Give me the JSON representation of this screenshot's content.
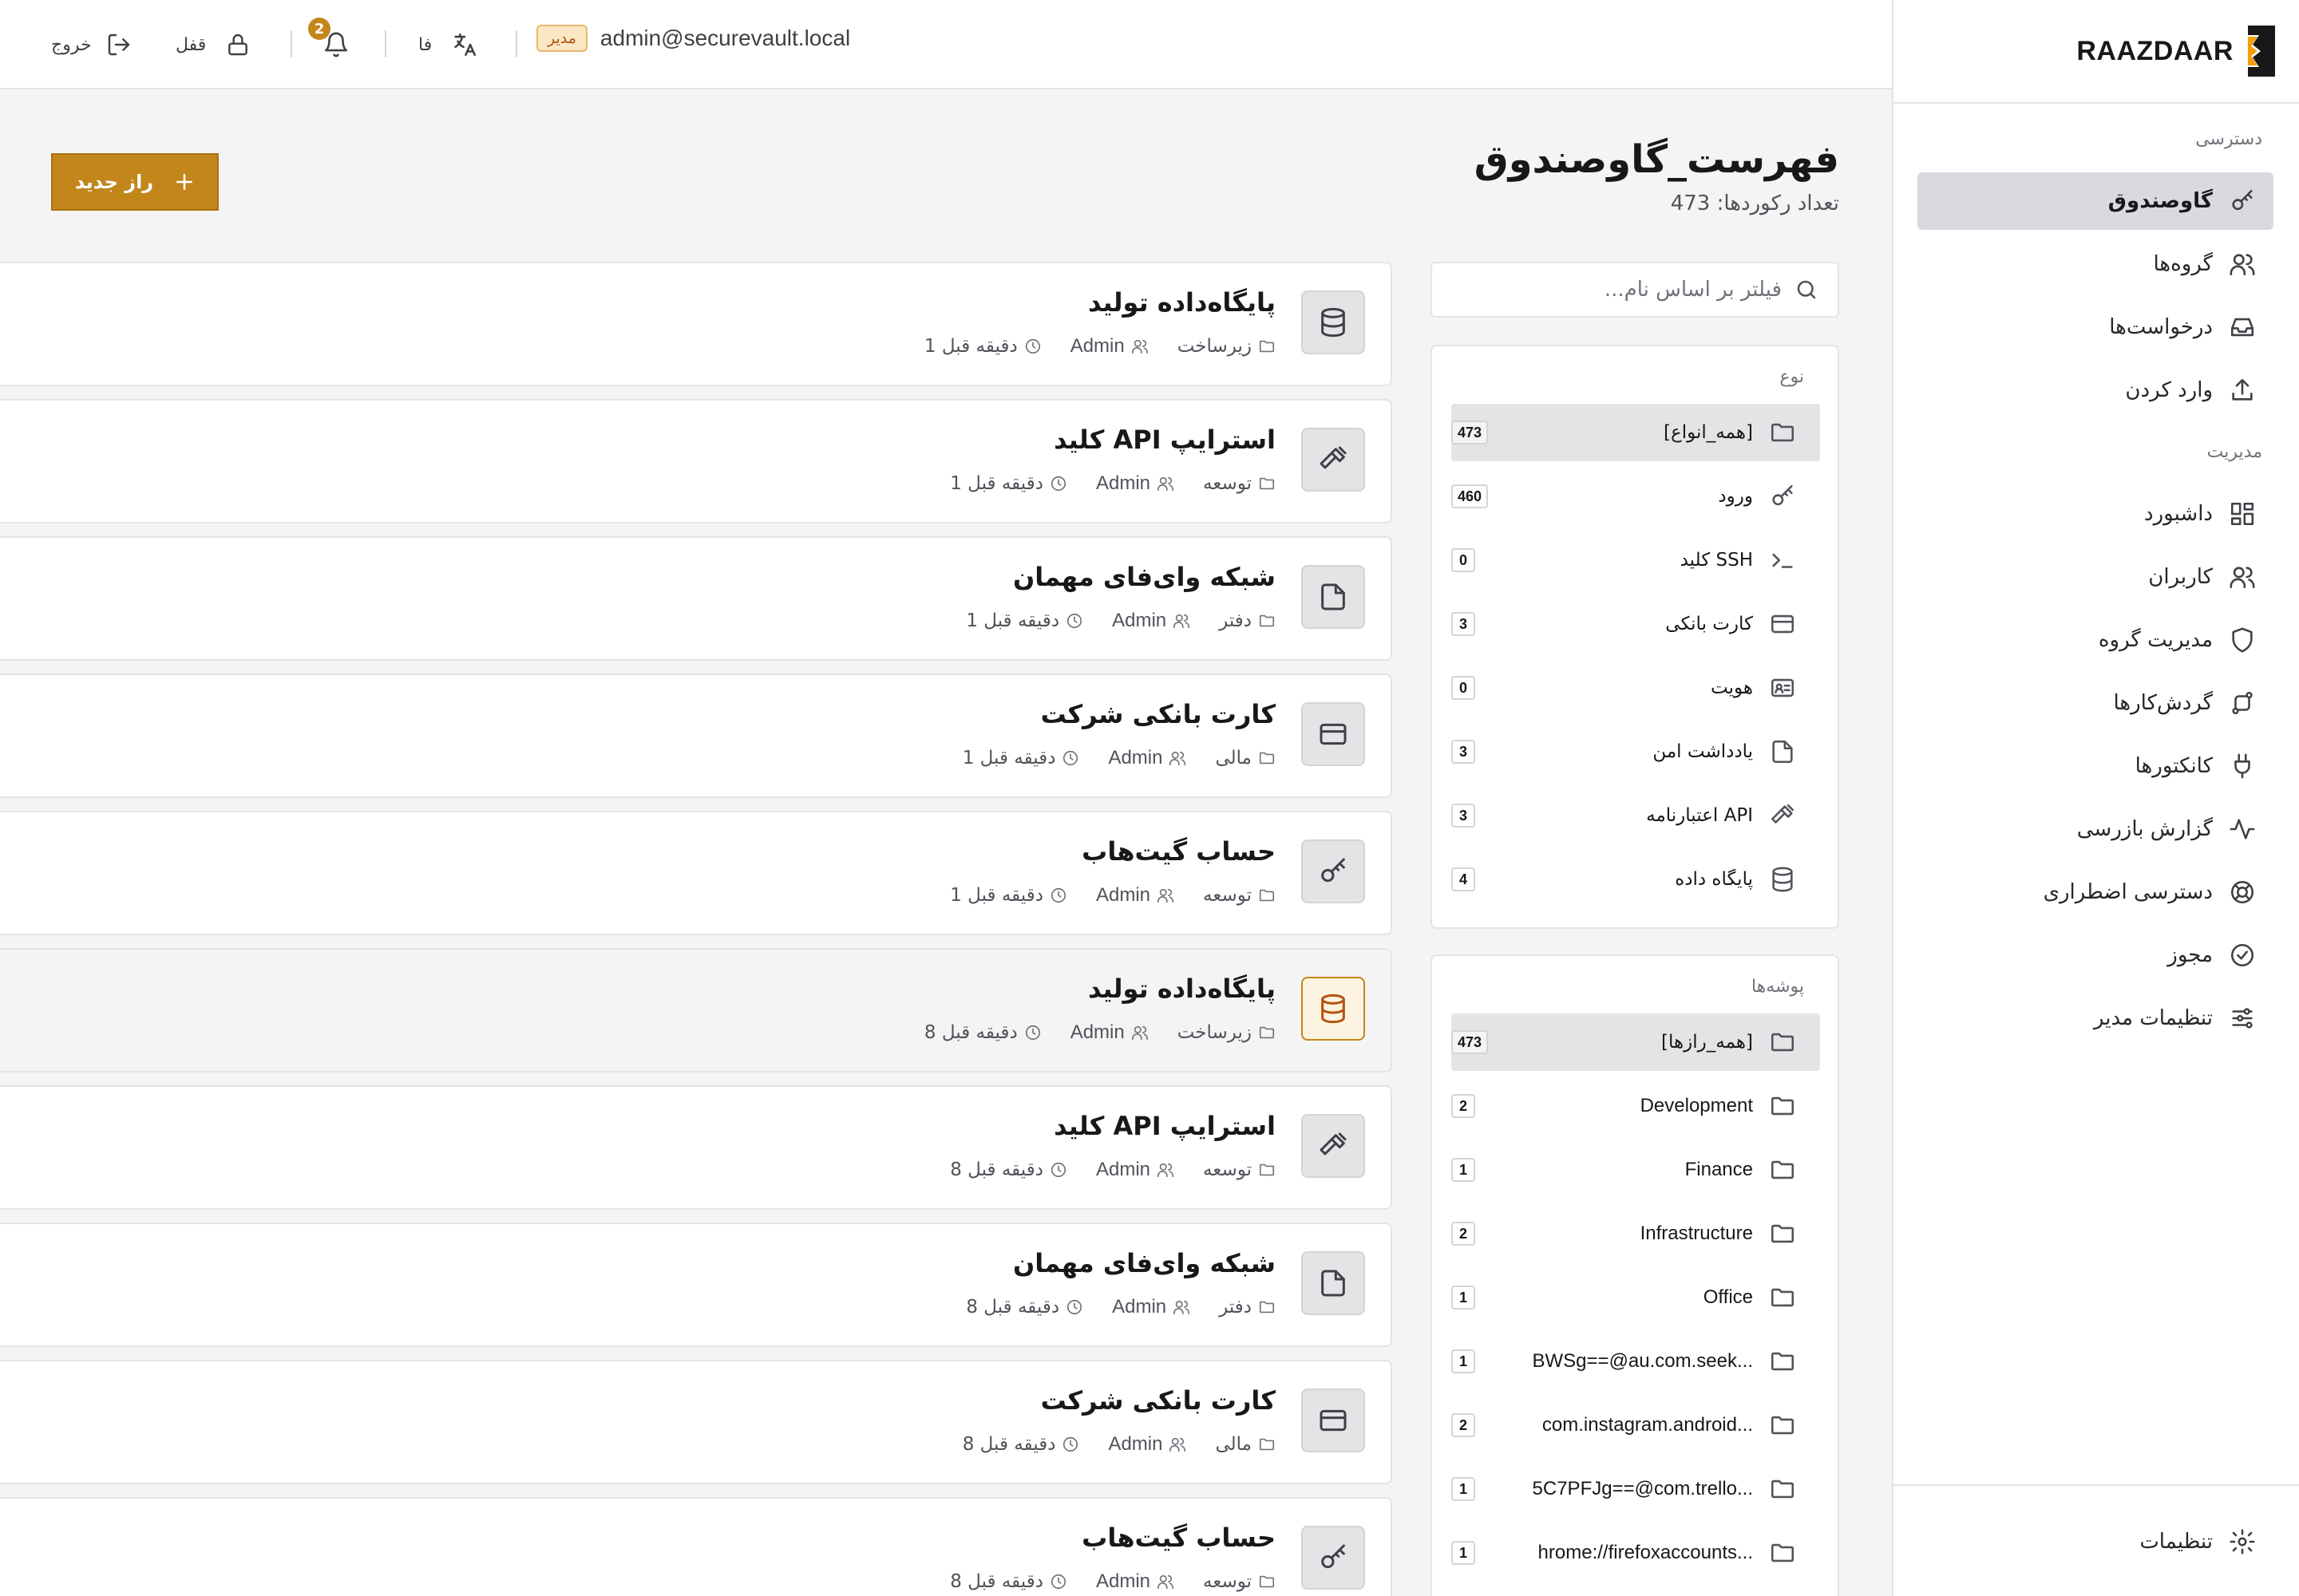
{
  "brand": {
    "name": "RAAZDAAR"
  },
  "topbar": {
    "email": "admin@securevault.local",
    "role": "مدیر",
    "language": "فا",
    "notifications_count": "2",
    "lock_label": "قفل",
    "logout_label": "خروج"
  },
  "sidebar": {
    "access_title": "دسترسی",
    "access_items": [
      {
        "label": "گاوصندوق",
        "icon": "key-icon",
        "active": true
      },
      {
        "label": "گروه‌ها",
        "icon": "users-icon"
      },
      {
        "label": "درخواست‌ها",
        "icon": "inbox-icon"
      },
      {
        "label": "وارد کردن",
        "icon": "upload-icon"
      }
    ],
    "admin_title": "مدیریت",
    "admin_items": [
      {
        "label": "داشبورد",
        "icon": "dashboard-icon"
      },
      {
        "label": "کاربران",
        "icon": "users-icon"
      },
      {
        "label": "مدیریت گروه",
        "icon": "shield-icon"
      },
      {
        "label": "گردش‌کارها",
        "icon": "workflow-icon"
      },
      {
        "label": "کانکتورها",
        "icon": "plug-icon"
      },
      {
        "label": "گزارش بازرسی",
        "icon": "activity-icon"
      },
      {
        "label": "دسترسی اضطراری",
        "icon": "lifebuoy-icon"
      },
      {
        "label": "مجوز",
        "icon": "badge-check-icon"
      },
      {
        "label": "تنظیمات مدیر",
        "icon": "sliders-icon"
      }
    ],
    "settings_label": "تنظیمات"
  },
  "header": {
    "title": "فهرست_گاوصندوق",
    "subtitle": "تعداد رکوردها: 473",
    "new_button": "راز جدید"
  },
  "search": {
    "placeholder": "فیلتر بر اساس نام..."
  },
  "types": {
    "title": "نوع",
    "items": [
      {
        "label": "[همه_انواع]",
        "count": "473",
        "icon": "folder-icon",
        "active": true
      },
      {
        "label": "ورود",
        "count": "460",
        "icon": "key-icon"
      },
      {
        "label": "کلید SSH",
        "count": "0",
        "icon": "terminal-icon"
      },
      {
        "label": "کارت بانکی",
        "count": "3",
        "icon": "credit-card-icon"
      },
      {
        "label": "هویت",
        "count": "0",
        "icon": "id-card-icon"
      },
      {
        "label": "یادداشت امن",
        "count": "3",
        "icon": "note-icon"
      },
      {
        "label": "اعتبارنامه API",
        "count": "3",
        "icon": "hammer-icon"
      },
      {
        "label": "پایگاه داده",
        "count": "4",
        "icon": "database-icon"
      }
    ]
  },
  "folders": {
    "title": "پوشه‌ها",
    "items": [
      {
        "label": "[همه_رازها]",
        "count": "473",
        "active": true
      },
      {
        "label": "Development",
        "count": "2",
        "ltr": true
      },
      {
        "label": "Finance",
        "count": "1",
        "ltr": true
      },
      {
        "label": "Infrastructure",
        "count": "2",
        "ltr": true
      },
      {
        "label": "Office",
        "count": "1",
        "ltr": true
      },
      {
        "label": "BWSg==@au.com.seek...",
        "count": "1",
        "ltr": true
      },
      {
        "label": "com.instagram.android...",
        "count": "2",
        "ltr": true
      },
      {
        "label": "5C7PFJg==@com.trello...",
        "count": "1",
        "ltr": true
      },
      {
        "label": "hrome://firefoxaccounts...",
        "count": "1",
        "ltr": true
      }
    ]
  },
  "items": [
    {
      "title": "پایگاه‌داده تولید",
      "folder": "زیرساخت",
      "owner": "Admin",
      "time": "1 دقیقه قبل",
      "icon": "database-icon"
    },
    {
      "title": "کلید API استرایپ",
      "folder": "توسعه",
      "owner": "Admin",
      "time": "1 دقیقه قبل",
      "icon": "hammer-icon"
    },
    {
      "title": "شبکه وای‌فای مهمان",
      "folder": "دفتر",
      "owner": "Admin",
      "time": "1 دقیقه قبل",
      "icon": "note-icon"
    },
    {
      "title": "کارت بانکی شرکت",
      "folder": "مالی",
      "owner": "Admin",
      "time": "1 دقیقه قبل",
      "icon": "credit-card-icon"
    },
    {
      "title": "حساب گیت‌هاب",
      "folder": "توسعه",
      "owner": "Admin",
      "time": "1 دقیقه قبل",
      "icon": "key-icon"
    },
    {
      "title": "پایگاه‌داده تولید",
      "folder": "زیرساخت",
      "owner": "Admin",
      "time": "8 دقیقه قبل",
      "icon": "database-icon",
      "selected": true
    },
    {
      "title": "کلید API استرایپ",
      "folder": "توسعه",
      "owner": "Admin",
      "time": "8 دقیقه قبل",
      "icon": "hammer-icon"
    },
    {
      "title": "شبکه وای‌فای مهمان",
      "folder": "دفتر",
      "owner": "Admin",
      "time": "8 دقیقه قبل",
      "icon": "note-icon"
    },
    {
      "title": "کارت بانکی شرکت",
      "folder": "مالی",
      "owner": "Admin",
      "time": "8 دقیقه قبل",
      "icon": "credit-card-icon"
    },
    {
      "title": "حساب گیت‌هاب",
      "folder": "توسعه",
      "owner": "Admin",
      "time": "8 دقیقه قبل",
      "icon": "key-icon"
    }
  ],
  "colors": {
    "accent": "#c2861a",
    "sidebar_active_bg": "#d9dadf",
    "page_bg": "#f4f4f5",
    "role_badge_bg": "#fbe7c6"
  }
}
